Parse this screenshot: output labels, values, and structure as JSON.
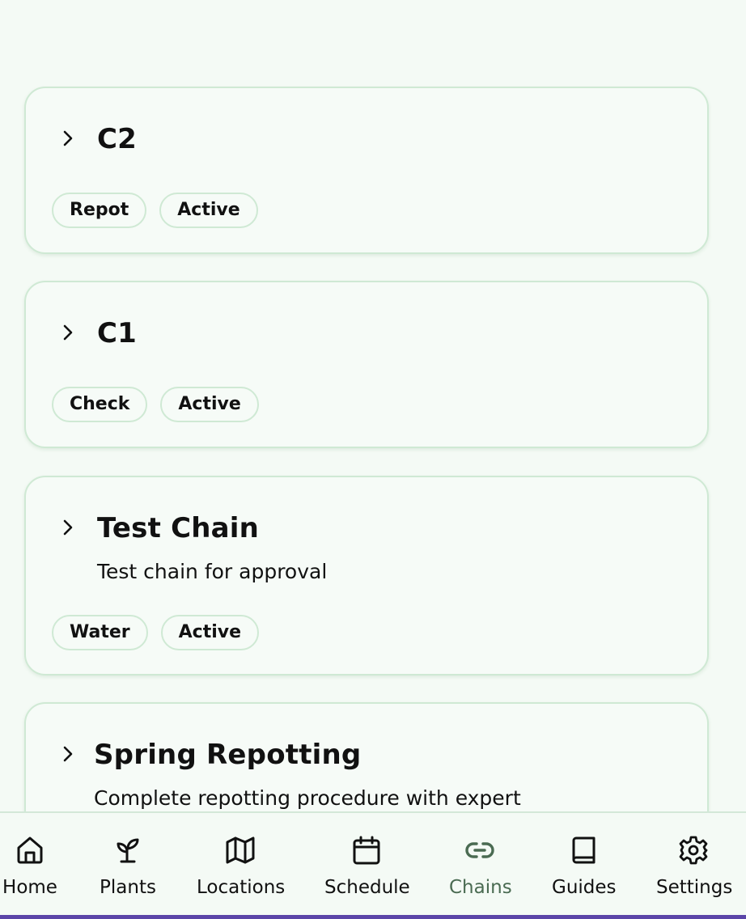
{
  "chains": [
    {
      "title": "C2",
      "description": "",
      "tags": [
        "Repot",
        "Active"
      ]
    },
    {
      "title": "C1",
      "description": "",
      "tags": [
        "Check",
        "Active"
      ]
    },
    {
      "title": "Test Chain",
      "description": "Test chain for approval",
      "tags": [
        "Water",
        "Active"
      ]
    },
    {
      "title": "Spring Repotting",
      "description": "Complete repotting procedure with expert",
      "tags": []
    }
  ],
  "nav": {
    "active": "Chains",
    "active_color": "#4a6b52",
    "items": [
      {
        "label": "Home",
        "icon": "home-icon"
      },
      {
        "label": "Plants",
        "icon": "sprout-icon"
      },
      {
        "label": "Locations",
        "icon": "map-icon"
      },
      {
        "label": "Schedule",
        "icon": "calendar-icon"
      },
      {
        "label": "Chains",
        "icon": "link-icon"
      },
      {
        "label": "Guides",
        "icon": "book-icon"
      },
      {
        "label": "Settings",
        "icon": "gear-icon"
      }
    ]
  },
  "colors": {
    "background": "#f4faf5",
    "border": "#cfe9d4",
    "accent_bar": "#5b45a8"
  }
}
